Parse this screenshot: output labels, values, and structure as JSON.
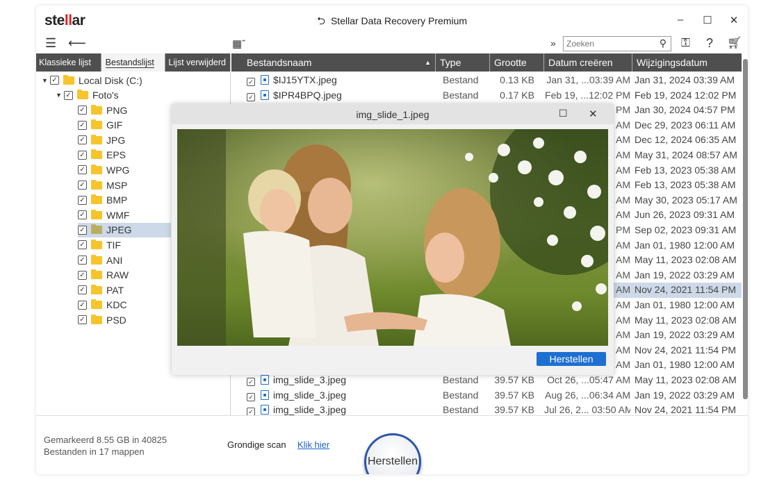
{
  "app": {
    "logo_prefix": "ste",
    "logo_ll": "ll",
    "logo_suffix": "ar",
    "title": "Stellar Data Recovery Premium",
    "window_controls": {
      "minimize": "–",
      "maximize": "☐",
      "close": "✕"
    }
  },
  "toolbar": {
    "search_placeholder": "Zoeken"
  },
  "tabs": [
    {
      "label": "Klassieke lijst",
      "active": false
    },
    {
      "label": "Bestandslijst",
      "active": true
    },
    {
      "label": "Lijst verwijderd",
      "active": false
    }
  ],
  "tree": {
    "root": "Local Disk (C:)",
    "folder": "Foto's",
    "children": [
      "PNG",
      "GIF",
      "JPG",
      "EPS",
      "WPG",
      "MSP",
      "BMP",
      "WMF",
      "JPEG",
      "TIF",
      "ANI",
      "RAW",
      "PAT",
      "KDC",
      "PSD"
    ],
    "selected": "JPEG"
  },
  "table": {
    "headers": {
      "name": "Bestandsnaam",
      "type": "Type",
      "size": "Grootte",
      "created": "Datum creëren",
      "modified": "Wijzigingsdatum"
    },
    "rows": [
      {
        "name": "$IJ15YTX.jpeg",
        "type": "Bestand",
        "size": "0.13 KB",
        "created": "Jan 31, ...03:39 AM",
        "modified": "Jan 31, 2024 03:39 AM"
      },
      {
        "name": "$IPR4BPQ.jpeg",
        "type": "Bestand",
        "size": "0.17 KB",
        "created": "Feb 19, ...12:02 PM",
        "modified": "Feb 19, 2024 12:02 PM"
      },
      {
        "created": "PM",
        "modified": "Jan 30, 2024 04:57 PM"
      },
      {
        "created": "AM",
        "modified": "Dec 29, 2023 06:11 AM"
      },
      {
        "created": "AM",
        "modified": "Dec 12, 2024 06:35 AM"
      },
      {
        "created": "AM",
        "modified": "May 31, 2024 08:57 AM"
      },
      {
        "created": "AM",
        "modified": "Feb 13, 2023 05:38 AM"
      },
      {
        "created": "AM",
        "modified": "Feb 13, 2023 05:38 AM"
      },
      {
        "created": "AM",
        "modified": "May 30, 2023 05:17 AM"
      },
      {
        "created": "AM",
        "modified": "Jun 26, 2023 09:31 AM"
      },
      {
        "created": "PM",
        "modified": "Sep 02, 2023 09:31 AM"
      },
      {
        "created": "AM",
        "modified": "Jan 01, 1980 12:00 AM"
      },
      {
        "created": "AM",
        "modified": "May 11, 2023 02:08 AM"
      },
      {
        "created": "AM",
        "modified": "Jan 19, 2022 03:29 AM"
      },
      {
        "created": "AM",
        "modified": "Nov 24, 2021 11:54 PM"
      },
      {
        "created": "AM",
        "modified": "Jan 01, 1980 12:00 AM"
      },
      {
        "created": "AM",
        "modified": "May 11, 2023 02:08 AM"
      },
      {
        "created": "AM",
        "modified": "Jan 19, 2022 03:29 AM"
      },
      {
        "created": "AM",
        "modified": "Nov 24, 2021 11:54 PM"
      },
      {
        "created": "AM",
        "modified": "Jan 01, 1980 12:00 AM"
      },
      {
        "name": "img_slide_3.jpeg",
        "type": "Bestand",
        "size": "39.57 KB",
        "created": "Oct 26, ...05:47 AM",
        "modified": "May 11, 2023 02:08 AM"
      },
      {
        "name": "img_slide_3.jpeg",
        "type": "Bestand",
        "size": "39.57 KB",
        "created": "Aug 26, ...06:34 AM",
        "modified": "Jan 19, 2022 03:29 AM"
      },
      {
        "name": "img_slide_3.jpeg",
        "type": "Bestand",
        "size": "39.57 KB",
        "created": "Jul 26, 2... 03:50 AM",
        "modified": "Nov 24, 2021 11:54 PM"
      }
    ],
    "selected_row": 14
  },
  "dialog": {
    "title": "img_slide_1.jpeg",
    "maximize": "☐",
    "close": "✕",
    "button": "Herstellen"
  },
  "footer": {
    "marked_line1": "Gemarkeerd 8.55 GB in 40825",
    "marked_line2": "Bestanden in 17 mappen",
    "scan_label": "Grondige scan",
    "scan_link": "Klik hier",
    "recover_button": "Herstellen"
  },
  "colors": {
    "accent": "#1d6fd1",
    "header_bg": "#4f4f4f",
    "selection": "#cdd9e8",
    "logo_red": "#e02020",
    "folder": "#f8c42c"
  }
}
